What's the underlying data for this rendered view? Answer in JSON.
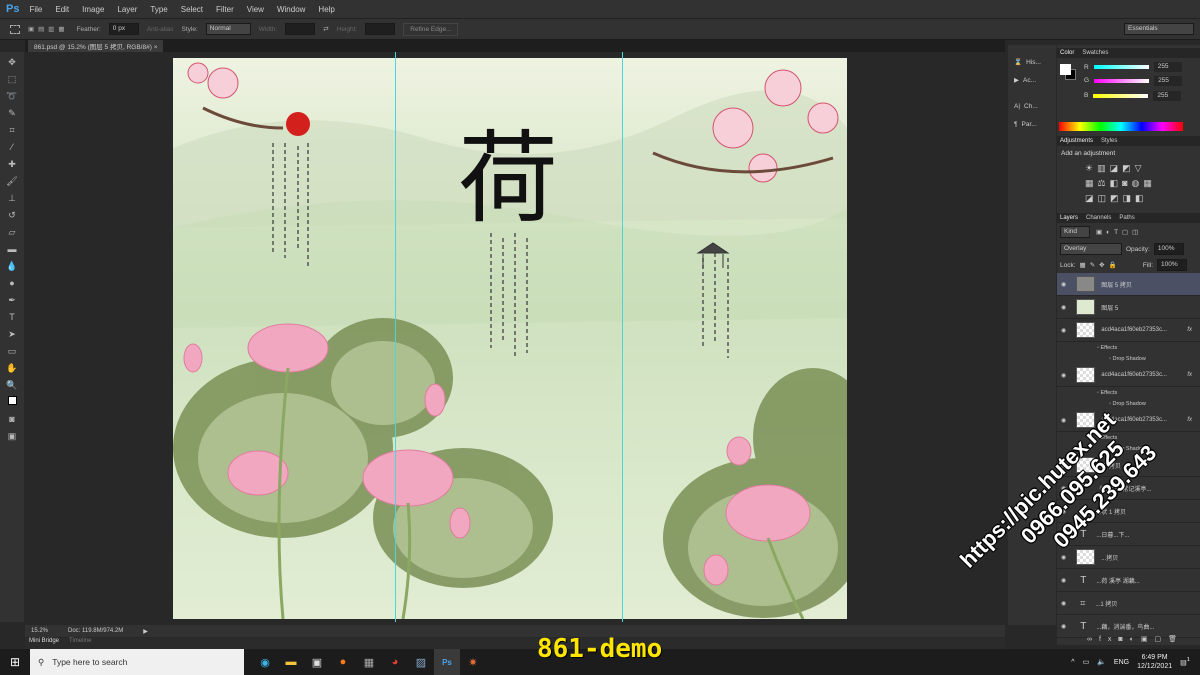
{
  "app": {
    "logo": "Ps",
    "menu": [
      "File",
      "Edit",
      "Image",
      "Layer",
      "Type",
      "Select",
      "Filter",
      "View",
      "Window",
      "Help"
    ]
  },
  "options": {
    "feather_label": "Feather:",
    "feather_value": "0 px",
    "antialias": "Anti-alias",
    "style_label": "Style:",
    "style_value": "Normal",
    "width_label": "Width:",
    "height_label": "Height:",
    "refine": "Refine Edge...",
    "workspace": "Essentials"
  },
  "document": {
    "tab": "861.psd @ 15.2% (图层 5 拷贝, RGB/8#)",
    "close": "×",
    "zoom": "15.2%",
    "doc_size": "Doc: 119.8M/974.2M",
    "artwork_title_glyph": "荷"
  },
  "bottom_tabs": [
    "Mini Bridge",
    "Timeline"
  ],
  "left_dock": [
    {
      "icon": "history-icon",
      "label": "His..."
    },
    {
      "icon": "actions-icon",
      "label": "Ac..."
    },
    {
      "icon": "character-icon",
      "label": "Ch..."
    },
    {
      "icon": "paragraph-icon",
      "label": "Par..."
    }
  ],
  "color_panel": {
    "tabs": [
      "Color",
      "Swatches"
    ],
    "r_label": "R",
    "g_label": "G",
    "b_label": "B",
    "r": "255",
    "g": "255",
    "b": "255"
  },
  "adjustments": {
    "tabs": [
      "Adjustments",
      "Styles"
    ],
    "title": "Add an adjustment"
  },
  "layers_panel": {
    "tabs": [
      "Layers",
      "Channels",
      "Paths"
    ],
    "filter": "Kind",
    "blend": "Overlay",
    "opacity_label": "Opacity:",
    "opacity": "100%",
    "lock_label": "Lock:",
    "fill_label": "Fill:",
    "fill": "100%",
    "layers": [
      {
        "name": "图层 5 拷贝",
        "selected": true
      },
      {
        "name": "图层 5"
      },
      {
        "name": "acd4aca1f60eb27353c...",
        "fx": "fx",
        "effects": "Effects",
        "effect": "Drop Shadow"
      },
      {
        "name": "acd4aca1f60eb27353c...",
        "fx": "fx",
        "effects": "Effects",
        "effect": "Drop Shadow"
      },
      {
        "name": "acd4aca1f60eb27353c...",
        "fx": "fx",
        "effects": "Effects",
        "effect": "Drop Shadow"
      },
      {
        "name": "荷 拷贝"
      },
      {
        "name": "《如梦令·常记溪亭...",
        "type": "text"
      },
      {
        "name": "形状 1 拷贝",
        "type": "shape"
      },
      {
        "name": "...日暮...下...",
        "type": "text"
      },
      {
        "name": "...拷贝"
      },
      {
        "name": "...荷 溪亭 湖藕...",
        "type": "text"
      },
      {
        "name": "...1 拷贝",
        "type": "shape"
      },
      {
        "name": "...藕，消湍番，鸟曲...",
        "type": "text"
      }
    ]
  },
  "taskbar": {
    "search_placeholder": "Type here to search",
    "lang": "ENG",
    "time": "6:49 PM",
    "date": "12/12/2021",
    "notifications": "1"
  },
  "overlay": {
    "demo": "861-demo",
    "watermark": [
      "https://pic.hutex.net",
      "0966.095.625",
      "0945.239.643"
    ]
  },
  "colors": {
    "accent": "#4aa3e8",
    "guide": "#48d8d8",
    "demo": "#ffe600"
  }
}
